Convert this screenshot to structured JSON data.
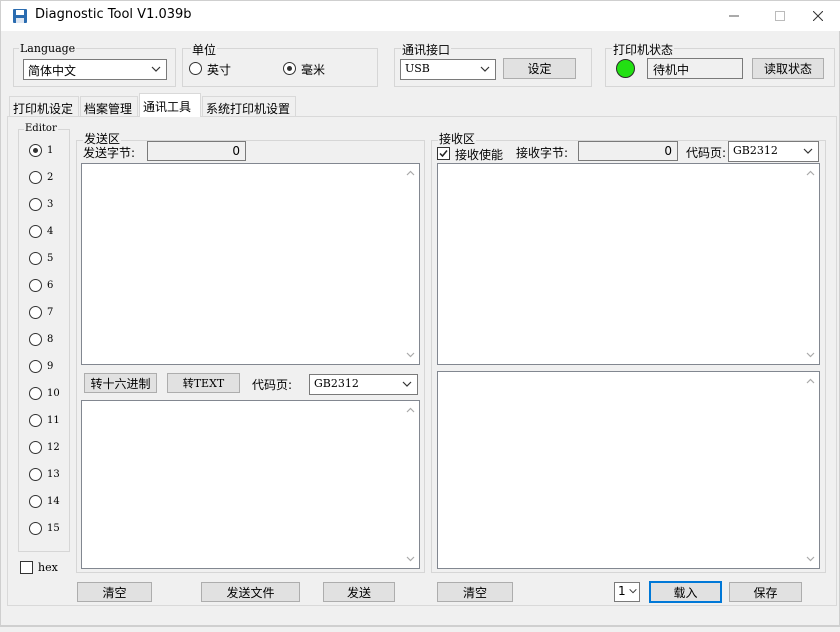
{
  "window": {
    "title": "Diagnostic Tool V1.039b",
    "icon": "floppy-disk-icon",
    "controls": {
      "minimize": "minimize-icon",
      "maximize": "maximize-icon",
      "close": "close-icon"
    }
  },
  "language": {
    "group_label": "Language",
    "selected": "简体中文"
  },
  "unit": {
    "group_label": "单位",
    "options": [
      {
        "label": "英寸",
        "checked": false
      },
      {
        "label": "毫米",
        "checked": true
      }
    ]
  },
  "comm_port": {
    "group_label": "通讯接口",
    "selected": "USB",
    "set_button": "设定"
  },
  "printer_status": {
    "group_label": "打印机状态",
    "status_text": "待机中",
    "led_color": "#22e013",
    "read_button": "读取状态"
  },
  "tabs": [
    {
      "label": "打印机设定",
      "active": false
    },
    {
      "label": "档案管理",
      "active": false
    },
    {
      "label": "通讯工具",
      "active": true
    },
    {
      "label": "系统打印机设置",
      "active": false
    }
  ],
  "editor": {
    "group_label": "Editor",
    "items": [
      {
        "label": "1",
        "checked": true
      },
      {
        "label": "2",
        "checked": false
      },
      {
        "label": "3",
        "checked": false
      },
      {
        "label": "4",
        "checked": false
      },
      {
        "label": "5",
        "checked": false
      },
      {
        "label": "6",
        "checked": false
      },
      {
        "label": "7",
        "checked": false
      },
      {
        "label": "8",
        "checked": false
      },
      {
        "label": "9",
        "checked": false
      },
      {
        "label": "10",
        "checked": false
      },
      {
        "label": "11",
        "checked": false
      },
      {
        "label": "12",
        "checked": false
      },
      {
        "label": "13",
        "checked": false
      },
      {
        "label": "14",
        "checked": false
      },
      {
        "label": "15",
        "checked": false
      }
    ],
    "hex_label": "hex",
    "hex_checked": false
  },
  "send": {
    "group_label": "发送区",
    "bytes_label": "发送字节:",
    "bytes_value": "0",
    "to_hex_button": "转十六进制",
    "to_text_button": "转TEXT",
    "codepage_label": "代码页:",
    "codepage_value": "GB2312",
    "clear_button": "清空",
    "send_file_button": "发送文件",
    "send_button": "发送"
  },
  "receive": {
    "group_label": "接收区",
    "enable_label": "接收使能",
    "enable_checked": true,
    "bytes_label": "接收字节:",
    "bytes_value": "0",
    "codepage_label": "代码页:",
    "codepage_value": "GB2312",
    "clear_button": "清空",
    "page_value": "1",
    "load_button": "载入",
    "save_button": "保存"
  }
}
